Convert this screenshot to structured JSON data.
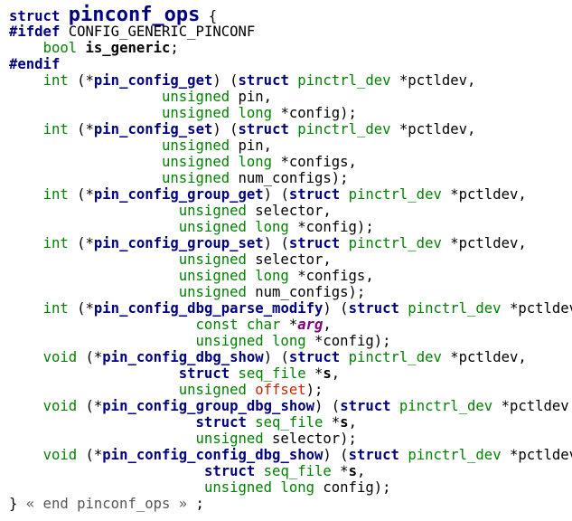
{
  "code": {
    "lines": [
      [
        {
          "t": "struct ",
          "c": "kw"
        },
        {
          "t": "pinconf_ops",
          "c": "title"
        },
        {
          "t": " {",
          "c": "punc"
        }
      ],
      [
        {
          "t": "#ifdef",
          "c": "pp"
        },
        {
          "t": " CONFIG_GENERIC_PINCONF",
          "c": "plain"
        }
      ],
      [
        {
          "t": "    ",
          "c": "plain"
        },
        {
          "t": "bool",
          "c": "type"
        },
        {
          "t": " ",
          "c": "plain"
        },
        {
          "t": "is_generic",
          "c": "pbold"
        },
        {
          "t": ";",
          "c": "punc"
        }
      ],
      [
        {
          "t": "#endif",
          "c": "pp"
        }
      ],
      [
        {
          "t": "    ",
          "c": "plain"
        },
        {
          "t": "int",
          "c": "type"
        },
        {
          "t": " (*",
          "c": "punc"
        },
        {
          "t": "pin_config_get",
          "c": "fn"
        },
        {
          "t": ") (",
          "c": "punc"
        },
        {
          "t": "struct",
          "c": "kw"
        },
        {
          "t": " ",
          "c": "plain"
        },
        {
          "t": "pinctrl_dev",
          "c": "type"
        },
        {
          "t": " *pctldev,",
          "c": "param"
        }
      ],
      [
        {
          "t": "                  ",
          "c": "plain"
        },
        {
          "t": "unsigned",
          "c": "type"
        },
        {
          "t": " pin,",
          "c": "param"
        }
      ],
      [
        {
          "t": "                  ",
          "c": "plain"
        },
        {
          "t": "unsigned long",
          "c": "type"
        },
        {
          "t": " *config);",
          "c": "param"
        }
      ],
      [
        {
          "t": "    ",
          "c": "plain"
        },
        {
          "t": "int",
          "c": "type"
        },
        {
          "t": " (*",
          "c": "punc"
        },
        {
          "t": "pin_config_set",
          "c": "fn"
        },
        {
          "t": ") (",
          "c": "punc"
        },
        {
          "t": "struct",
          "c": "kw"
        },
        {
          "t": " ",
          "c": "plain"
        },
        {
          "t": "pinctrl_dev",
          "c": "type"
        },
        {
          "t": " *pctldev,",
          "c": "param"
        }
      ],
      [
        {
          "t": "                  ",
          "c": "plain"
        },
        {
          "t": "unsigned",
          "c": "type"
        },
        {
          "t": " pin,",
          "c": "param"
        }
      ],
      [
        {
          "t": "                  ",
          "c": "plain"
        },
        {
          "t": "unsigned long",
          "c": "type"
        },
        {
          "t": " *configs,",
          "c": "param"
        }
      ],
      [
        {
          "t": "                  ",
          "c": "plain"
        },
        {
          "t": "unsigned",
          "c": "type"
        },
        {
          "t": " num_configs);",
          "c": "param"
        }
      ],
      [
        {
          "t": "    ",
          "c": "plain"
        },
        {
          "t": "int",
          "c": "type"
        },
        {
          "t": " (*",
          "c": "punc"
        },
        {
          "t": "pin_config_group_get",
          "c": "fn"
        },
        {
          "t": ") (",
          "c": "punc"
        },
        {
          "t": "struct",
          "c": "kw"
        },
        {
          "t": " ",
          "c": "plain"
        },
        {
          "t": "pinctrl_dev",
          "c": "type"
        },
        {
          "t": " *pctldev,",
          "c": "param"
        }
      ],
      [
        {
          "t": "                    ",
          "c": "plain"
        },
        {
          "t": "unsigned",
          "c": "type"
        },
        {
          "t": " selector,",
          "c": "param"
        }
      ],
      [
        {
          "t": "                    ",
          "c": "plain"
        },
        {
          "t": "unsigned long",
          "c": "type"
        },
        {
          "t": " *config);",
          "c": "param"
        }
      ],
      [
        {
          "t": "    ",
          "c": "plain"
        },
        {
          "t": "int",
          "c": "type"
        },
        {
          "t": " (*",
          "c": "punc"
        },
        {
          "t": "pin_config_group_set",
          "c": "fn"
        },
        {
          "t": ") (",
          "c": "punc"
        },
        {
          "t": "struct",
          "c": "kw"
        },
        {
          "t": " ",
          "c": "plain"
        },
        {
          "t": "pinctrl_dev",
          "c": "type"
        },
        {
          "t": " *pctldev,",
          "c": "param"
        }
      ],
      [
        {
          "t": "                    ",
          "c": "plain"
        },
        {
          "t": "unsigned",
          "c": "type"
        },
        {
          "t": " selector,",
          "c": "param"
        }
      ],
      [
        {
          "t": "                    ",
          "c": "plain"
        },
        {
          "t": "unsigned long",
          "c": "type"
        },
        {
          "t": " *configs,",
          "c": "param"
        }
      ],
      [
        {
          "t": "                    ",
          "c": "plain"
        },
        {
          "t": "unsigned",
          "c": "type"
        },
        {
          "t": " num_configs);",
          "c": "param"
        }
      ],
      [
        {
          "t": "    ",
          "c": "plain"
        },
        {
          "t": "int",
          "c": "type"
        },
        {
          "t": " (*",
          "c": "punc"
        },
        {
          "t": "pin_config_dbg_parse_modify",
          "c": "fn"
        },
        {
          "t": ") (",
          "c": "punc"
        },
        {
          "t": "struct",
          "c": "kw"
        },
        {
          "t": " ",
          "c": "plain"
        },
        {
          "t": "pinctrl_dev",
          "c": "type"
        },
        {
          "t": " *pctldev,",
          "c": "param"
        }
      ],
      [
        {
          "t": "                      ",
          "c": "plain"
        },
        {
          "t": "const char",
          "c": "type"
        },
        {
          "t": " *",
          "c": "param"
        },
        {
          "t": "arg",
          "c": "ital"
        },
        {
          "t": ",",
          "c": "param"
        }
      ],
      [
        {
          "t": "                      ",
          "c": "plain"
        },
        {
          "t": "unsigned long",
          "c": "type"
        },
        {
          "t": " *config);",
          "c": "param"
        }
      ],
      [
        {
          "t": "    ",
          "c": "plain"
        },
        {
          "t": "void",
          "c": "type"
        },
        {
          "t": " (*",
          "c": "punc"
        },
        {
          "t": "pin_config_dbg_show",
          "c": "fn"
        },
        {
          "t": ") (",
          "c": "punc"
        },
        {
          "t": "struct",
          "c": "kw"
        },
        {
          "t": " ",
          "c": "plain"
        },
        {
          "t": "pinctrl_dev",
          "c": "type"
        },
        {
          "t": " *pctldev,",
          "c": "param"
        }
      ],
      [
        {
          "t": "                    ",
          "c": "plain"
        },
        {
          "t": "struct",
          "c": "kw"
        },
        {
          "t": " ",
          "c": "plain"
        },
        {
          "t": "seq_file",
          "c": "type"
        },
        {
          "t": " *",
          "c": "param"
        },
        {
          "t": "s",
          "c": "pbold"
        },
        {
          "t": ",",
          "c": "param"
        }
      ],
      [
        {
          "t": "                    ",
          "c": "plain"
        },
        {
          "t": "unsigned",
          "c": "type"
        },
        {
          "t": " ",
          "c": "plain"
        },
        {
          "t": "offset",
          "c": "red"
        },
        {
          "t": ");",
          "c": "param"
        }
      ],
      [
        {
          "t": "    ",
          "c": "plain"
        },
        {
          "t": "void",
          "c": "type"
        },
        {
          "t": " (*",
          "c": "punc"
        },
        {
          "t": "pin_config_group_dbg_show",
          "c": "fn"
        },
        {
          "t": ") (",
          "c": "punc"
        },
        {
          "t": "struct",
          "c": "kw"
        },
        {
          "t": " ",
          "c": "plain"
        },
        {
          "t": "pinctrl_dev",
          "c": "type"
        },
        {
          "t": " *pctldev,",
          "c": "param"
        }
      ],
      [
        {
          "t": "                      ",
          "c": "plain"
        },
        {
          "t": "struct",
          "c": "kw"
        },
        {
          "t": " ",
          "c": "plain"
        },
        {
          "t": "seq_file",
          "c": "type"
        },
        {
          "t": " *",
          "c": "param"
        },
        {
          "t": "s",
          "c": "pbold"
        },
        {
          "t": ",",
          "c": "param"
        }
      ],
      [
        {
          "t": "                      ",
          "c": "plain"
        },
        {
          "t": "unsigned",
          "c": "type"
        },
        {
          "t": " selector);",
          "c": "param"
        }
      ],
      [
        {
          "t": "    ",
          "c": "plain"
        },
        {
          "t": "void",
          "c": "type"
        },
        {
          "t": " (*",
          "c": "punc"
        },
        {
          "t": "pin_config_config_dbg_show",
          "c": "fn"
        },
        {
          "t": ") (",
          "c": "punc"
        },
        {
          "t": "struct",
          "c": "kw"
        },
        {
          "t": " ",
          "c": "plain"
        },
        {
          "t": "pinctrl_dev",
          "c": "type"
        },
        {
          "t": " *pctldev,",
          "c": "param"
        }
      ],
      [
        {
          "t": "                       ",
          "c": "plain"
        },
        {
          "t": "struct",
          "c": "kw"
        },
        {
          "t": " ",
          "c": "plain"
        },
        {
          "t": "seq_file",
          "c": "type"
        },
        {
          "t": " *",
          "c": "param"
        },
        {
          "t": "s",
          "c": "pbold"
        },
        {
          "t": ",",
          "c": "param"
        }
      ],
      [
        {
          "t": "                       ",
          "c": "plain"
        },
        {
          "t": "unsigned long",
          "c": "type"
        },
        {
          "t": " config);",
          "c": "param"
        }
      ],
      [
        {
          "t": "} ",
          "c": "punc"
        },
        {
          "t": "« end pinconf_ops »",
          "c": "gray"
        },
        {
          "t": " ;",
          "c": "punc"
        }
      ]
    ]
  }
}
